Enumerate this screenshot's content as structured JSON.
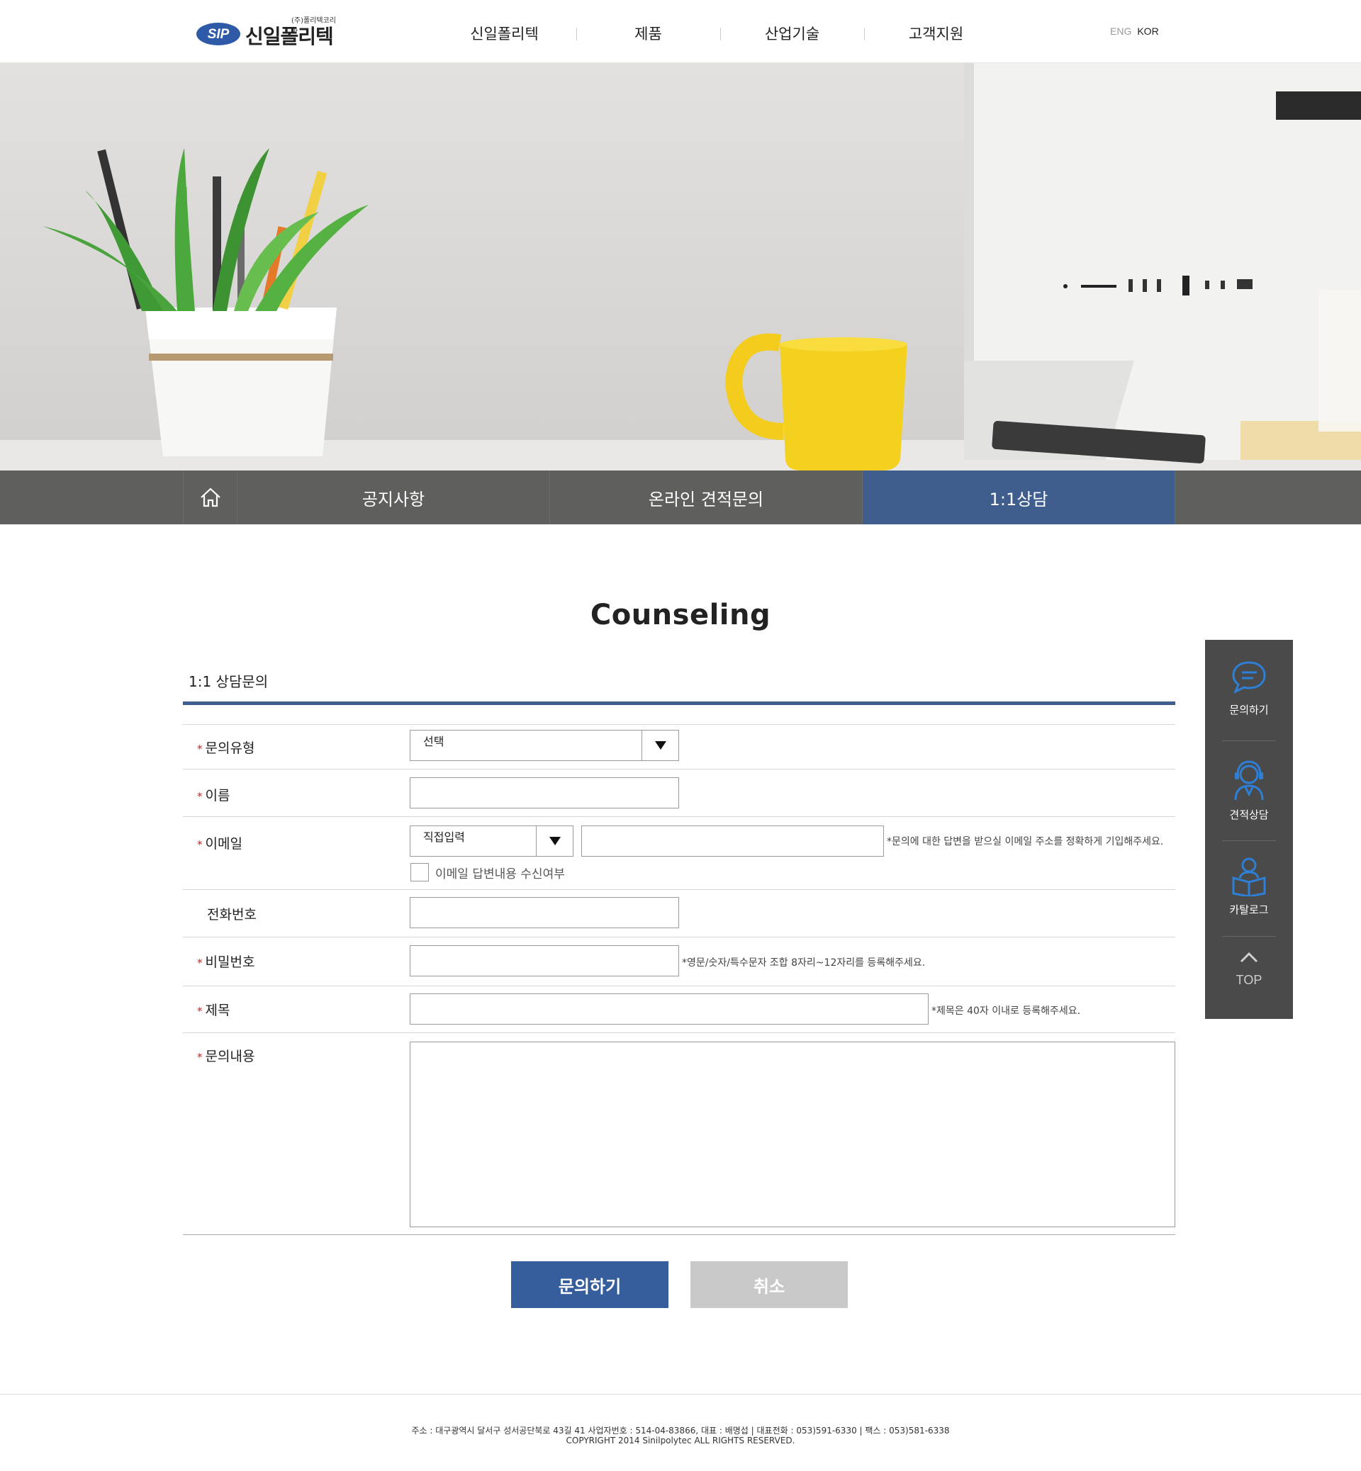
{
  "header": {
    "logo_small": "(주)폴리텍코리아",
    "logo_badge": "SIP",
    "logo_text": "신일폴리텍",
    "nav": [
      "신일폴리텍",
      "제품",
      "산업기술",
      "고객지원"
    ],
    "lang_eng": "ENG",
    "lang_kor": "KOR"
  },
  "subnav": {
    "tabs": [
      "공지사항",
      "온라인 견적문의",
      "1:1상담"
    ],
    "active_tab": "1:1상담"
  },
  "content": {
    "title": "Counseling",
    "section_title": "1:1 상담문의"
  },
  "form": {
    "required_mark": "*",
    "inquiry_type_label": "문의유형",
    "inquiry_type_value": "선택",
    "name_label": "이름",
    "email_label": "이메일",
    "email_domain_value": "직접입력",
    "email_hint": "*문의에 대한 답변을 받으실 이메일 주소를 정확하게 기입해주세요.",
    "email_receive_label": "이메일 답변내용 수신여부",
    "phone_label": "전화번호",
    "password_label": "비밀번호",
    "password_hint": "*영문/숫자/특수문자 조합 8자리~12자리를 등록해주세요.",
    "subject_label": "제목",
    "subject_hint": "*제목은 40자 이내로 등록해주세요.",
    "content_label": "문의내용"
  },
  "buttons": {
    "submit": "문의하기",
    "cancel": "취소"
  },
  "quick_menu": {
    "items": [
      "문의하기",
      "견적상담",
      "카탈로그"
    ],
    "top": "TOP"
  },
  "footer": {
    "address": "주소 : 대구광역시 달서구 성서공단북로 43길 41  사업자번호 : 514-04-83866, 대표 : 배명섭 | 대표전화 : 053)591-6330 | 팩스 : 053)581-6338",
    "copyright": "COPYRIGHT 2014 Sinilpolytec ALL RIGHTS RESERVED."
  },
  "colors": {
    "accent": "#3f5e8e",
    "button_blue": "#365e9d",
    "button_gray": "#c9c9c9",
    "quick_bg": "#4a4a4a",
    "required": "#d02020"
  }
}
